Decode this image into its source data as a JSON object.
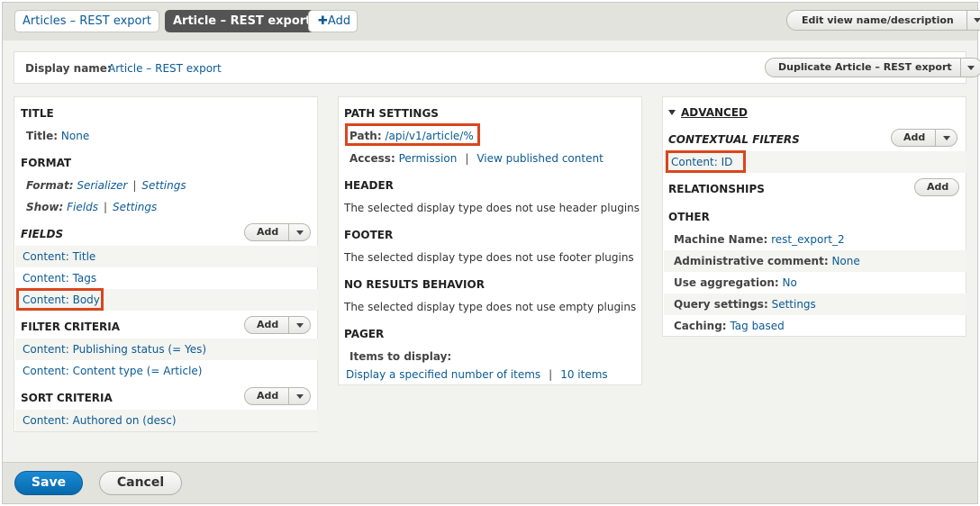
{
  "tabs": [
    {
      "label": "Articles – REST export"
    },
    {
      "label": "Article – REST export"
    }
  ],
  "add_tab": {
    "icon": "plus-icon",
    "label": "Add"
  },
  "edit_view_button": {
    "label": "Edit view name/description"
  },
  "display_name": {
    "label": "Display name:",
    "value": "Article – REST export"
  },
  "duplicate_button": {
    "label": "Duplicate Article – REST export"
  },
  "col1": {
    "title": {
      "heading": "TITLE",
      "label": "Title:",
      "value": "None"
    },
    "format": {
      "heading": "FORMAT",
      "format_label": "Format:",
      "format_value": "Serializer",
      "format_settings": "Settings",
      "show_label": "Show:",
      "show_value": "Fields",
      "show_settings": "Settings"
    },
    "fields": {
      "heading": "FIELDS",
      "add_label": "Add",
      "items": [
        "Content: Title",
        "Content: Tags",
        "Content: Body"
      ]
    },
    "filter_criteria": {
      "heading": "FILTER CRITERIA",
      "add_label": "Add",
      "items": [
        "Content: Publishing status (= Yes)",
        "Content: Content type (= Article)"
      ]
    },
    "sort_criteria": {
      "heading": "SORT CRITERIA",
      "add_label": "Add",
      "items": [
        "Content: Authored on (desc)"
      ]
    }
  },
  "col2": {
    "path_settings": {
      "heading": "PATH SETTINGS",
      "path_label": "Path:",
      "path_value": "/api/v1/article/%",
      "access_label": "Access:",
      "access_value": "Permission",
      "access_perm": "View published content"
    },
    "header": {
      "heading": "HEADER",
      "text": "The selected display type does not use header plugins"
    },
    "footer": {
      "heading": "FOOTER",
      "text": "The selected display type does not use footer plugins"
    },
    "no_results": {
      "heading": "NO RESULTS BEHAVIOR",
      "text": "The selected display type does not use empty plugins"
    },
    "pager": {
      "heading": "PAGER",
      "items_label": "Items to display:",
      "items_value": "Display a specified number of items",
      "items_count": "10 items"
    }
  },
  "col3": {
    "advanced": {
      "heading": "ADVANCED"
    },
    "contextual_filters": {
      "heading": "CONTEXTUAL FILTERS",
      "add_label": "Add",
      "items": [
        "Content: ID"
      ]
    },
    "relationships": {
      "heading": "RELATIONSHIPS",
      "add_label": "Add"
    },
    "other": {
      "heading": "OTHER",
      "machine_label": "Machine Name:",
      "machine_value": "rest_export_2",
      "admin_label": "Administrative comment:",
      "admin_value": "None",
      "agg_label": "Use aggregation:",
      "agg_value": "No",
      "query_label": "Query settings:",
      "query_value": "Settings",
      "caching_label": "Caching:",
      "caching_value": "Tag based"
    }
  },
  "footer_bar": {
    "save_label": "Save",
    "cancel_label": "Cancel"
  },
  "colors": {
    "link": "#0b5a95",
    "highlight": "#d9461d",
    "primary": "#0769ad"
  }
}
